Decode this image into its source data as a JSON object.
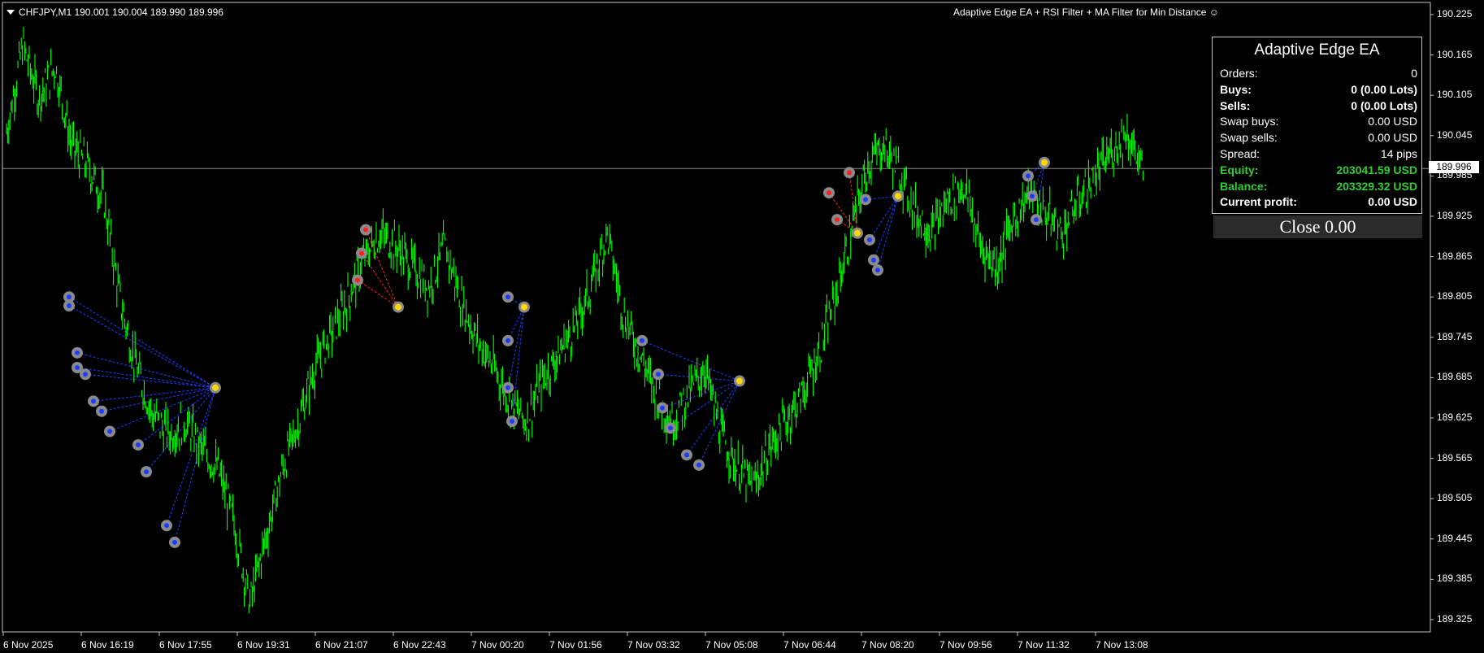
{
  "header": {
    "symbol_line": "CHFJPY,M1  190.001 190.004 189.990 189.996",
    "ea_title": "Adaptive Edge EA + RSI Filter + MA Filter for Min Distance ☺"
  },
  "panel": {
    "title": "Adaptive Edge EA",
    "rows": [
      {
        "label": "Orders:",
        "value": "0",
        "bold": false,
        "green": false
      },
      {
        "label": "Buys:",
        "value": "0 (0.00 Lots)",
        "bold": true,
        "green": false
      },
      {
        "label": "Sells:",
        "value": "0 (0.00 Lots)",
        "bold": true,
        "green": false
      },
      {
        "label": "Swap buys:",
        "value": "0.00 USD",
        "bold": false,
        "green": false
      },
      {
        "label": "Swap sells:",
        "value": "0.00 USD",
        "bold": false,
        "green": false
      },
      {
        "label": "Spread:",
        "value": "14 pips",
        "bold": false,
        "green": false
      },
      {
        "label": "Equity:",
        "value": "203041.59 USD",
        "bold": true,
        "green": true
      },
      {
        "label": "Balance:",
        "value": "203329.32 USD",
        "bold": true,
        "green": true
      },
      {
        "label": "Current profit:",
        "value": "0.00 USD",
        "bold": true,
        "green": false
      }
    ],
    "close_label": "Close 0.00"
  },
  "current_price": 189.996,
  "current_price_label": "189.996",
  "price_axis": [
    "190.225",
    "190.165",
    "190.105",
    "190.045",
    "189.985",
    "189.925",
    "189.865",
    "189.805",
    "189.745",
    "189.685",
    "189.625",
    "189.565",
    "189.505",
    "189.445",
    "189.385",
    "189.325"
  ],
  "time_axis": [
    "6 Nov 2025",
    "6 Nov 16:19",
    "6 Nov 17:55",
    "6 Nov 19:31",
    "6 Nov 21:07",
    "6 Nov 22:43",
    "7 Nov 00:20",
    "7 Nov 01:56",
    "7 Nov 03:32",
    "7 Nov 05:08",
    "7 Nov 06:44",
    "7 Nov 08:20",
    "7 Nov 09:56",
    "7 Nov 11:32",
    "7 Nov 13:08"
  ],
  "colors": {
    "background": "#000000",
    "candles": "#00ff00",
    "frame": "#c8c8c8",
    "bid_line": "#8c8c8c",
    "buy_marker": "#1e3cff",
    "sell_marker": "#ff2020",
    "close_marker": "#ffd700",
    "marker_halo": "#8a8a8a",
    "profit_green": "#32cd32"
  },
  "chart_data": {
    "type": "line",
    "symbol": "CHFJPY",
    "timeframe": "M1",
    "ylim": [
      189.3,
      190.24
    ],
    "x_range": [
      "6 Nov 2025",
      "7 Nov 14:30"
    ],
    "series": [
      {
        "values": [
          190.05,
          190.18,
          190.1,
          190.15,
          190.03,
          190.0,
          189.95,
          189.8,
          189.7,
          189.63,
          189.6,
          189.62,
          189.58,
          189.55,
          189.47,
          189.35,
          189.45,
          189.55,
          189.62,
          189.7,
          189.75,
          189.8,
          189.86,
          189.9,
          189.88,
          189.85,
          189.82,
          189.88,
          189.8,
          189.74,
          189.7,
          189.65,
          189.62,
          189.68,
          189.72,
          189.76,
          189.82,
          189.9,
          189.78,
          189.72,
          189.66,
          189.62,
          189.66,
          189.7,
          189.6,
          189.55,
          189.52,
          189.58,
          189.62,
          189.66,
          189.72,
          189.8,
          189.9,
          190.0,
          190.03,
          189.99,
          189.93,
          189.9,
          189.95,
          189.97,
          189.88,
          189.85,
          189.92,
          189.96,
          189.93,
          189.9,
          189.95,
          189.98,
          190.02,
          190.05,
          189.99
        ]
      }
    ],
    "trade_markers": [
      {
        "time": "6 Nov 16:00",
        "price": 189.805,
        "kind": "buy"
      },
      {
        "time": "6 Nov 16:00",
        "price": 189.792,
        "kind": "buy"
      },
      {
        "time": "6 Nov 16:10",
        "price": 189.722,
        "kind": "buy"
      },
      {
        "time": "6 Nov 16:10",
        "price": 189.7,
        "kind": "buy"
      },
      {
        "time": "6 Nov 16:20",
        "price": 189.69,
        "kind": "buy"
      },
      {
        "time": "6 Nov 16:30",
        "price": 189.65,
        "kind": "buy"
      },
      {
        "time": "6 Nov 16:40",
        "price": 189.635,
        "kind": "buy"
      },
      {
        "time": "6 Nov 16:50",
        "price": 189.605,
        "kind": "buy"
      },
      {
        "time": "6 Nov 17:25",
        "price": 189.585,
        "kind": "buy"
      },
      {
        "time": "6 Nov 17:35",
        "price": 189.545,
        "kind": "buy"
      },
      {
        "time": "6 Nov 18:00",
        "price": 189.465,
        "kind": "buy"
      },
      {
        "time": "6 Nov 18:10",
        "price": 189.44,
        "kind": "buy"
      },
      {
        "time": "6 Nov 19:00",
        "price": 189.67,
        "kind": "close"
      },
      {
        "time": "6 Nov 21:55",
        "price": 189.83,
        "kind": "sell"
      },
      {
        "time": "6 Nov 22:00",
        "price": 189.87,
        "kind": "sell"
      },
      {
        "time": "6 Nov 22:05",
        "price": 189.905,
        "kind": "sell"
      },
      {
        "time": "6 Nov 22:45",
        "price": 189.79,
        "kind": "close"
      },
      {
        "time": "7 Nov 01:00",
        "price": 189.805,
        "kind": "buy"
      },
      {
        "time": "7 Nov 01:00",
        "price": 189.74,
        "kind": "buy"
      },
      {
        "time": "7 Nov 01:00",
        "price": 189.67,
        "kind": "buy"
      },
      {
        "time": "7 Nov 01:05",
        "price": 189.62,
        "kind": "buy"
      },
      {
        "time": "7 Nov 01:20",
        "price": 189.79,
        "kind": "close"
      },
      {
        "time": "7 Nov 03:45",
        "price": 189.74,
        "kind": "buy"
      },
      {
        "time": "7 Nov 04:05",
        "price": 189.69,
        "kind": "buy"
      },
      {
        "time": "7 Nov 04:10",
        "price": 189.64,
        "kind": "buy"
      },
      {
        "time": "7 Nov 04:20",
        "price": 189.61,
        "kind": "buy"
      },
      {
        "time": "7 Nov 04:40",
        "price": 189.57,
        "kind": "buy"
      },
      {
        "time": "7 Nov 04:55",
        "price": 189.555,
        "kind": "buy"
      },
      {
        "time": "7 Nov 05:45",
        "price": 189.68,
        "kind": "close"
      },
      {
        "time": "7 Nov 07:35",
        "price": 189.96,
        "kind": "sell"
      },
      {
        "time": "7 Nov 07:45",
        "price": 189.92,
        "kind": "sell"
      },
      {
        "time": "7 Nov 08:00",
        "price": 189.99,
        "kind": "sell"
      },
      {
        "time": "7 Nov 08:20",
        "price": 189.95,
        "kind": "buy"
      },
      {
        "time": "7 Nov 08:25",
        "price": 189.89,
        "kind": "buy"
      },
      {
        "time": "7 Nov 08:30",
        "price": 189.86,
        "kind": "buy"
      },
      {
        "time": "7 Nov 08:35",
        "price": 189.845,
        "kind": "buy"
      },
      {
        "time": "7 Nov 08:10",
        "price": 189.9,
        "kind": "close"
      },
      {
        "time": "7 Nov 09:00",
        "price": 189.955,
        "kind": "close"
      },
      {
        "time": "7 Nov 11:40",
        "price": 189.985,
        "kind": "buy"
      },
      {
        "time": "7 Nov 11:45",
        "price": 189.955,
        "kind": "buy"
      },
      {
        "time": "7 Nov 11:50",
        "price": 189.92,
        "kind": "buy"
      },
      {
        "time": "7 Nov 12:00",
        "price": 190.005,
        "kind": "close"
      }
    ]
  }
}
